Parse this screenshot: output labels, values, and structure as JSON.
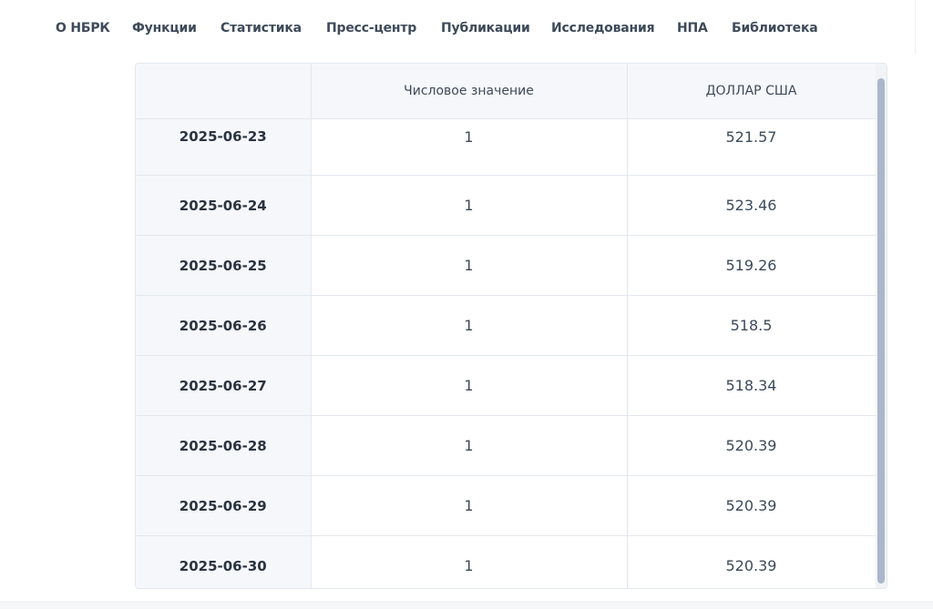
{
  "nav": {
    "items": [
      {
        "label": "О НБРК"
      },
      {
        "label": "Функции"
      },
      {
        "label": "Статистика"
      },
      {
        "label": "Пресс-центр"
      },
      {
        "label": "Публикации"
      },
      {
        "label": "Исследования"
      },
      {
        "label": "НПА"
      },
      {
        "label": "Библиотека"
      }
    ]
  },
  "table": {
    "headers": [
      "",
      "Числовое значение",
      "ДОЛЛАР США"
    ],
    "rows": [
      {
        "date": "2025-06-23",
        "amount": "1",
        "rate": "521.57"
      },
      {
        "date": "2025-06-24",
        "amount": "1",
        "rate": "523.46"
      },
      {
        "date": "2025-06-25",
        "amount": "1",
        "rate": "519.26"
      },
      {
        "date": "2025-06-26",
        "amount": "1",
        "rate": "518.5"
      },
      {
        "date": "2025-06-27",
        "amount": "1",
        "rate": "518.34"
      },
      {
        "date": "2025-06-28",
        "amount": "1",
        "rate": "520.39"
      },
      {
        "date": "2025-06-29",
        "amount": "1",
        "rate": "520.39"
      },
      {
        "date": "2025-06-30",
        "amount": "1",
        "rate": "520.39"
      }
    ]
  }
}
